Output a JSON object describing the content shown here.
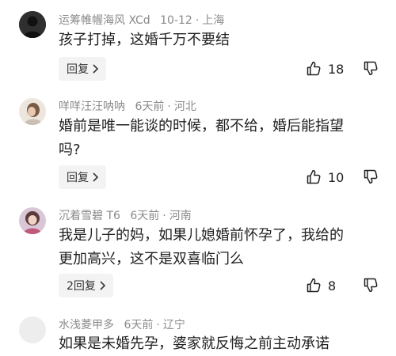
{
  "comments": [
    {
      "username": "运筹帷幄海风 XCd",
      "time": "10-12",
      "location": "上海",
      "lines": [
        "孩子打掉，这婚千万不要结"
      ],
      "reply_label": "回复",
      "likes": "18"
    },
    {
      "username": "咩咩汪汪呐呐",
      "time": "6天前",
      "location": "河北",
      "lines": [
        "婚前是唯一能谈的时候，都不给，婚后能指望",
        "吗?"
      ],
      "reply_label": "回复",
      "likes": "10"
    },
    {
      "username": "沉着雪碧 T6",
      "time": "6天前",
      "location": "河南",
      "lines": [
        "我是儿子的妈，如果儿媳婚前怀孕了，我给的",
        "更加高兴，这不是双喜临门么"
      ],
      "reply_label": "2回复",
      "likes": "8"
    },
    {
      "username": "水浅菱甲多",
      "time": "6天前",
      "location": "辽宁",
      "lines": [
        "如果是未婚先孕，婆家就反悔之前主动承诺"
      ]
    }
  ],
  "separator": "·",
  "icons": {
    "reply_chevron": "chevron-right-icon",
    "like": "thumb-up-icon",
    "dislike": "thumb-down-icon"
  }
}
